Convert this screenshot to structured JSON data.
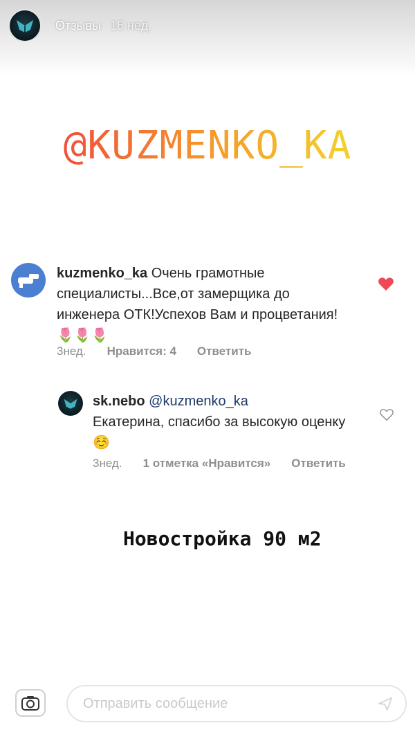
{
  "story": {
    "title": "Отзывы",
    "time": "16 нед."
  },
  "banner": {
    "handle": "@KUZMENKO_KA"
  },
  "comment": {
    "username": "kuzmenko_ka",
    "text": " Очень грамотные специалисты...Все,от замерщика до инженера ОТК!Успехов Вам и процветания!🌷🌷🌷",
    "time": "3нед.",
    "likes": "Нравится: 4",
    "reply": "Ответить",
    "liked": true
  },
  "reply": {
    "username": "sk.nebo",
    "mention": "@kuzmenko_ka",
    "text": "Екатерина, спасибо за высокую оценку ☺️",
    "time": "3нед.",
    "likes": "1 отметка «Нравится»",
    "reply": "Ответить"
  },
  "caption": "Новостройка 90 м2",
  "composer": {
    "placeholder": "Отправить сообщение"
  },
  "colors": {
    "accent_heart": "#ed4956",
    "comment_avatar": "#4b7fd1"
  },
  "icons": [
    "story-avatar-logo-icon",
    "comment-avatar-icon",
    "heart-filled-icon",
    "heart-outline-icon",
    "camera-icon",
    "send-icon"
  ]
}
